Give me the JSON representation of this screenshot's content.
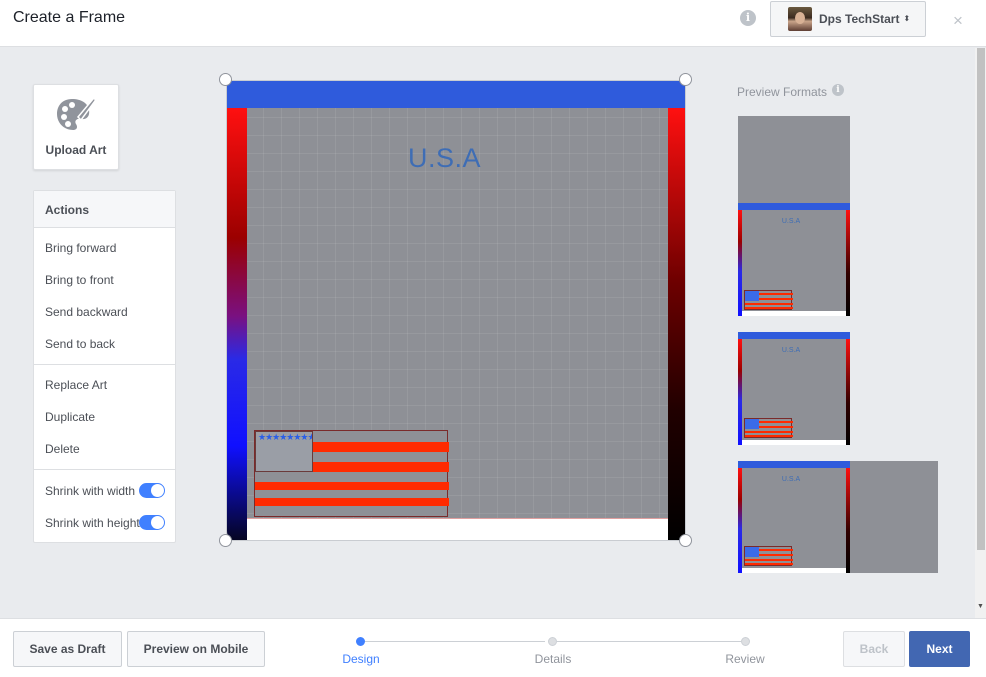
{
  "header": {
    "title": "Create a Frame",
    "info_glyph": "i",
    "account_name": "Dps TechStart",
    "caret": "⬍",
    "close": "×"
  },
  "upload": {
    "label": "Upload Art"
  },
  "actions": {
    "title": "Actions",
    "items": [
      "Bring forward",
      "Bring to front",
      "Send backward",
      "Send to back",
      "Replace Art",
      "Duplicate",
      "Delete"
    ],
    "toggles": [
      {
        "label": "Shrink with width",
        "on": true
      },
      {
        "label": "Shrink with height",
        "on": true
      }
    ]
  },
  "canvas": {
    "text": "U.S.A",
    "flag_stars": "★★★★★★★★★★★★★★★★★★★★★★★★★★★★★★★★★★★★★★★★"
  },
  "preview": {
    "title": "Preview Formats",
    "info_glyph": "i",
    "thumb_text": "U.S.A"
  },
  "footer": {
    "save_draft": "Save as Draft",
    "preview_mobile": "Preview on Mobile",
    "steps": [
      "Design",
      "Details",
      "Review"
    ],
    "active_step": 0,
    "back": "Back",
    "next": "Next"
  },
  "colors": {
    "accent": "#4080ff",
    "next_button": "#4267b2",
    "frame_top": "#2f5bdc",
    "flag_red": "#ff2a00"
  }
}
